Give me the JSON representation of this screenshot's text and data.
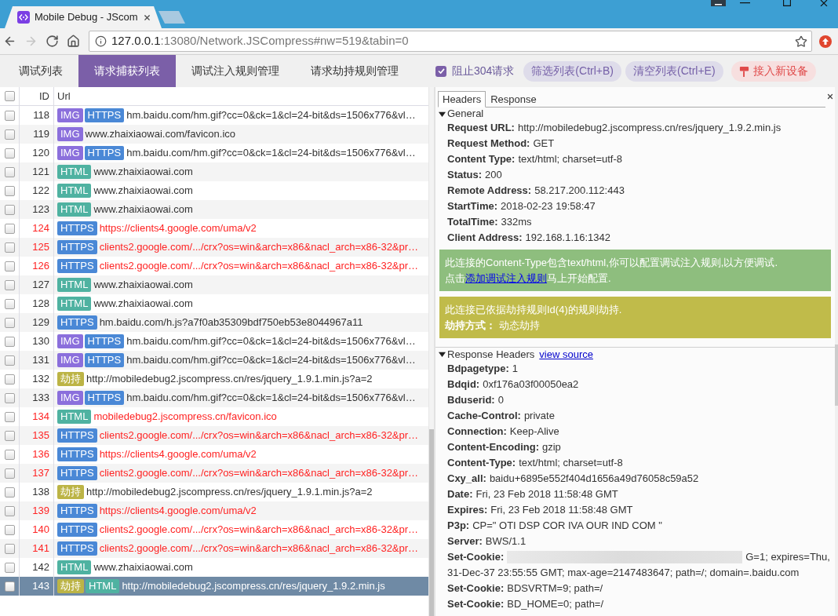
{
  "browser": {
    "tab": {
      "title": "Mobile Debug - JScom"
    },
    "nav_buttons": [
      {
        "kind": "back",
        "disabled": false
      },
      {
        "kind": "forward",
        "disabled": true
      },
      {
        "kind": "reload",
        "disabled": false
      },
      {
        "kind": "home",
        "disabled": false
      }
    ],
    "address": {
      "host": "127.0.0.1",
      "rest": ":13080/Network.JSCompress#nw=519&tabin=0"
    }
  },
  "nav": {
    "tabs": [
      {
        "label": "调试列表",
        "selected": false
      },
      {
        "label": "请求捕获列表",
        "selected": true
      },
      {
        "label": "调试注入规则管理",
        "selected": false
      },
      {
        "label": "请求劫持规则管理",
        "selected": false
      }
    ],
    "block_304": {
      "label": "阻止304请求",
      "checked": true
    },
    "buttons": [
      {
        "label": "筛选列表(Ctrl+B)",
        "kind": "pill"
      },
      {
        "label": "清空列表(Ctrl+E)",
        "kind": "pill"
      },
      {
        "label": "接入新设备",
        "kind": "connect"
      }
    ]
  },
  "list": {
    "columns": [
      "ID",
      "Url"
    ],
    "all_checked": false,
    "rows": [
      {
        "id": "118",
        "checked": false,
        "selected": false,
        "error": false,
        "tags": [
          {
            "kind": "img",
            "label": "IMG"
          },
          {
            "kind": "https",
            "label": "HTTPS"
          }
        ],
        "url": "hm.baidu.com/hm.gif?cc=0&ck=1&cl=24-bit&ds=1506x776&vl…"
      },
      {
        "id": "119",
        "checked": false,
        "selected": false,
        "error": false,
        "tags": [
          {
            "kind": "img",
            "label": "IMG"
          }
        ],
        "url": "www.zhaixiaowai.com/favicon.ico"
      },
      {
        "id": "120",
        "checked": false,
        "selected": false,
        "error": false,
        "tags": [
          {
            "kind": "img",
            "label": "IMG"
          },
          {
            "kind": "https",
            "label": "HTTPS"
          }
        ],
        "url": "hm.baidu.com/hm.gif?cc=0&ck=1&cl=24-bit&ds=1506x776&vl…"
      },
      {
        "id": "121",
        "checked": false,
        "selected": false,
        "error": false,
        "tags": [
          {
            "kind": "html",
            "label": "HTML"
          }
        ],
        "url": "www.zhaixiaowai.com"
      },
      {
        "id": "122",
        "checked": false,
        "selected": false,
        "error": false,
        "tags": [
          {
            "kind": "html",
            "label": "HTML"
          }
        ],
        "url": "www.zhaixiaowai.com"
      },
      {
        "id": "123",
        "checked": false,
        "selected": false,
        "error": false,
        "tags": [
          {
            "kind": "html",
            "label": "HTML"
          }
        ],
        "url": "www.zhaixiaowai.com"
      },
      {
        "id": "124",
        "checked": false,
        "selected": false,
        "error": true,
        "tags": [
          {
            "kind": "https",
            "label": "HTTPS"
          }
        ],
        "url": "https://clients4.google.com/uma/v2"
      },
      {
        "id": "125",
        "checked": false,
        "selected": false,
        "error": true,
        "tags": [
          {
            "kind": "https",
            "label": "HTTPS"
          }
        ],
        "url": "clients2.google.com/.../crx?os=win&arch=x86&nacl_arch=x86-32&pr…"
      },
      {
        "id": "126",
        "checked": false,
        "selected": false,
        "error": true,
        "tags": [
          {
            "kind": "https",
            "label": "HTTPS"
          }
        ],
        "url": "clients2.google.com/.../crx?os=win&arch=x86&nacl_arch=x86-32&pr…"
      },
      {
        "id": "127",
        "checked": false,
        "selected": false,
        "error": false,
        "tags": [
          {
            "kind": "html",
            "label": "HTML"
          }
        ],
        "url": "www.zhaixiaowai.com"
      },
      {
        "id": "128",
        "checked": false,
        "selected": false,
        "error": false,
        "tags": [
          {
            "kind": "html",
            "label": "HTML"
          }
        ],
        "url": "www.zhaixiaowai.com"
      },
      {
        "id": "129",
        "checked": false,
        "selected": false,
        "error": false,
        "tags": [
          {
            "kind": "https",
            "label": "HTTPS"
          }
        ],
        "url": "hm.baidu.com/h.js?a7f0ab35309bdf750eb53e8044967a11"
      },
      {
        "id": "130",
        "checked": false,
        "selected": false,
        "error": false,
        "tags": [
          {
            "kind": "img",
            "label": "IMG"
          },
          {
            "kind": "https",
            "label": "HTTPS"
          }
        ],
        "url": "hm.baidu.com/hm.gif?cc=0&ck=1&cl=24-bit&ds=1506x776&vl…"
      },
      {
        "id": "131",
        "checked": false,
        "selected": false,
        "error": false,
        "tags": [
          {
            "kind": "img",
            "label": "IMG"
          },
          {
            "kind": "https",
            "label": "HTTPS"
          }
        ],
        "url": "hm.baidu.com/hm.gif?cc=0&ck=1&cl=24-bit&ds=1506x776&vl…"
      },
      {
        "id": "132",
        "checked": false,
        "selected": false,
        "error": false,
        "tags": [
          {
            "kind": "hijack",
            "label": "劫持"
          }
        ],
        "url": "http://mobiledebug2.jscompress.cn/res/jquery_1.9.1.min.js?a=2"
      },
      {
        "id": "133",
        "checked": false,
        "selected": false,
        "error": false,
        "tags": [
          {
            "kind": "img",
            "label": "IMG"
          },
          {
            "kind": "https",
            "label": "HTTPS"
          }
        ],
        "url": "hm.baidu.com/hm.gif?cc=0&ck=1&cl=24-bit&ds=1506x776&vl…"
      },
      {
        "id": "134",
        "checked": false,
        "selected": false,
        "error": true,
        "tags": [
          {
            "kind": "html",
            "label": "HTML"
          }
        ],
        "url": "mobiledebug2.jscompress.cn/favicon.ico"
      },
      {
        "id": "135",
        "checked": false,
        "selected": false,
        "error": true,
        "tags": [
          {
            "kind": "https",
            "label": "HTTPS"
          }
        ],
        "url": "clients2.google.com/.../crx?os=win&arch=x86&nacl_arch=x86-32&pr…"
      },
      {
        "id": "136",
        "checked": false,
        "selected": false,
        "error": true,
        "tags": [
          {
            "kind": "https",
            "label": "HTTPS"
          }
        ],
        "url": "https://clients4.google.com/uma/v2"
      },
      {
        "id": "137",
        "checked": false,
        "selected": false,
        "error": true,
        "tags": [
          {
            "kind": "https",
            "label": "HTTPS"
          }
        ],
        "url": "clients2.google.com/.../crx?os=win&arch=x86&nacl_arch=x86-32&pr…"
      },
      {
        "id": "138",
        "checked": false,
        "selected": false,
        "error": false,
        "tags": [
          {
            "kind": "hijack",
            "label": "劫持"
          }
        ],
        "url": "http://mobiledebug2.jscompress.cn/res/jquery_1.9.1.min.js?a=2"
      },
      {
        "id": "139",
        "checked": false,
        "selected": false,
        "error": true,
        "tags": [
          {
            "kind": "https",
            "label": "HTTPS"
          }
        ],
        "url": "https://clients4.google.com/uma/v2"
      },
      {
        "id": "140",
        "checked": false,
        "selected": false,
        "error": true,
        "tags": [
          {
            "kind": "https",
            "label": "HTTPS"
          }
        ],
        "url": "clients2.google.com/.../crx?os=win&arch=x86&nacl_arch=x86-32&pr…"
      },
      {
        "id": "141",
        "checked": false,
        "selected": false,
        "error": true,
        "tags": [
          {
            "kind": "https",
            "label": "HTTPS"
          }
        ],
        "url": "clients2.google.com/.../crx?os=win&arch=x86&nacl_arch=x86-32&pr…"
      },
      {
        "id": "142",
        "checked": false,
        "selected": false,
        "error": false,
        "tags": [
          {
            "kind": "html",
            "label": "HTML"
          }
        ],
        "url": "www.zhaixiaowai.com"
      },
      {
        "id": "143",
        "checked": false,
        "selected": true,
        "error": false,
        "tags": [
          {
            "kind": "hijack",
            "label": "劫持"
          },
          {
            "kind": "html",
            "label": "HTML"
          }
        ],
        "url": "http://mobiledebug2.jscompress.cn/res/jquery_1.9.2.min.js"
      }
    ]
  },
  "details": {
    "tabs": [
      {
        "label": "Headers",
        "selected": true
      },
      {
        "label": "Response",
        "selected": false
      }
    ],
    "general": {
      "title": "General",
      "expanded": true,
      "fields": [
        {
          "name": "Request URL:",
          "value": "http://mobiledebug2.jscompress.cn/res/jquery_1.9.2.min.js"
        },
        {
          "name": "Request Method:",
          "value": "GET"
        },
        {
          "name": "Content Type:",
          "value": "text/html; charset=utf-8"
        },
        {
          "name": "Status:",
          "value": "200"
        },
        {
          "name": "Remote Address:",
          "value": "58.217.200.112:443"
        },
        {
          "name": "StartTime:",
          "value": "2018-02-23 19:58:47"
        },
        {
          "name": "TotalTime:",
          "value": "332ms"
        },
        {
          "name": "Client Address:",
          "value": "192.168.1.16:1342"
        }
      ]
    },
    "notices": [
      {
        "kind": "inject",
        "text": "此连接的Content-Type包含text/html,你可以配置调试注入规则,以方便调试.",
        "action_prefix": "点击",
        "link": "添加调试注入规则",
        "action_suffix": "马上开始配置."
      },
      {
        "kind": "hijack",
        "text": "此连接已依据劫持规则Id(4)的规则劫持.",
        "detail": "**劫持方式：** 动态劫持"
      }
    ],
    "response_headers": {
      "title": "Response Headers",
      "link": "view source",
      "expanded": true,
      "fields": [
        {
          "name": "Bdpagetype:",
          "value": "1",
          "redacted": false
        },
        {
          "name": "Bdqid:",
          "value": "0xf176a03f00050ea2",
          "redacted": false
        },
        {
          "name": "Bduserid:",
          "value": "0",
          "redacted": false
        },
        {
          "name": "Cache-Control:",
          "value": "private",
          "redacted": false
        },
        {
          "name": "Connection:",
          "value": "Keep-Alive",
          "redacted": false
        },
        {
          "name": "Content-Encoding:",
          "value": "gzip",
          "redacted": false
        },
        {
          "name": "Content-Type:",
          "value": "text/html; charset=utf-8",
          "redacted": false
        },
        {
          "name": "Cxy_all:",
          "value": "baidu+6895e552f404d1656a49d76058c59a52",
          "redacted": false
        },
        {
          "name": "Date:",
          "value": "Fri, 23 Feb 2018 11:58:48 GMT",
          "redacted": false
        },
        {
          "name": "Expires:",
          "value": "Fri, 23 Feb 2018 11:58:48 GMT",
          "redacted": false
        },
        {
          "name": "P3p:",
          "value": "CP=\" OTI DSP COR IVA OUR IND COM \"",
          "redacted": false
        },
        {
          "name": "Server:",
          "value": "BWS/1.1",
          "redacted": false
        },
        {
          "name": "Set-Cookie:",
          "value": "G=1; expires=Thu, 31-Dec-37 23:55:55 GMT; max-age=2147483647; path=/; domain=.baidu.com",
          "redacted": true
        },
        {
          "name": "Set-Cookie:",
          "value": "BDSVRTM=9; path=/",
          "redacted": false
        },
        {
          "name": "Set-Cookie:",
          "value": "BD_HOME=0; path=/",
          "redacted": false
        }
      ]
    }
  }
}
